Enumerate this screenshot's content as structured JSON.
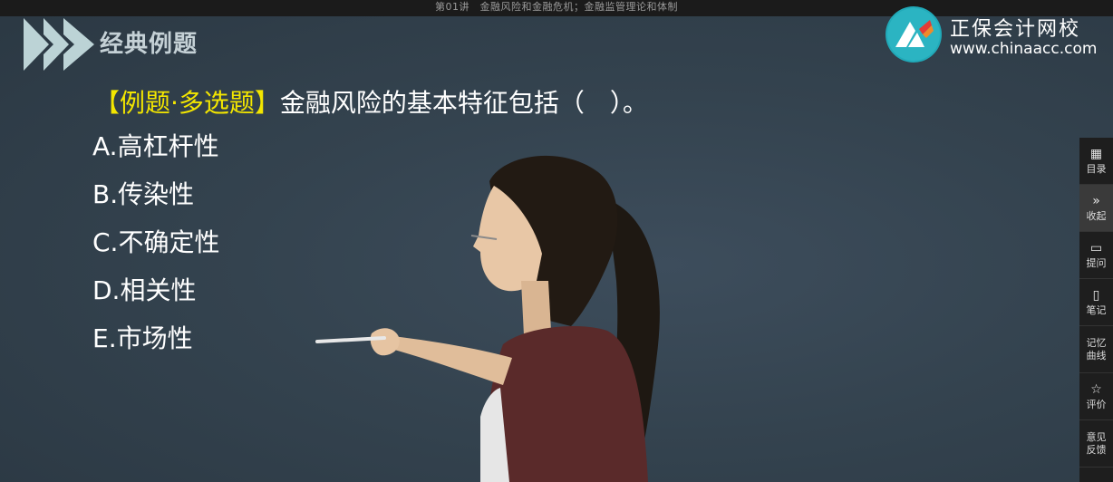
{
  "topbar": {
    "title": "第01讲　金融风险和金融危机；金融监管理论和体制"
  },
  "section": {
    "title": "经典例题"
  },
  "brand": {
    "name": "正保会计网校",
    "url": "www.chinaacc.com"
  },
  "question": {
    "tag": "【例题·多选题】",
    "text": "金融风险的基本特征包括（　）。",
    "options": [
      {
        "label": "A.高杠杆性"
      },
      {
        "label": "B.传染性"
      },
      {
        "label": "C.不确定性"
      },
      {
        "label": "D.相关性"
      },
      {
        "label": "E.市场性"
      }
    ]
  },
  "sidebar": {
    "items": [
      {
        "icon": "grid-icon",
        "label": "目录"
      },
      {
        "icon": "double-chevron-icon",
        "label": "收起"
      },
      {
        "icon": "chat-icon",
        "label": "提问"
      },
      {
        "icon": "note-icon",
        "label": "笔记"
      },
      {
        "icon": "none",
        "label": "记忆曲线"
      },
      {
        "icon": "star-icon",
        "label": "评价"
      },
      {
        "icon": "none",
        "label": "意见反馈"
      }
    ]
  },
  "colors": {
    "background": "#34434f",
    "question_tag": "#f3e600",
    "brand_teal": "#21a9b8",
    "sidebar": "#1e1e1e"
  }
}
